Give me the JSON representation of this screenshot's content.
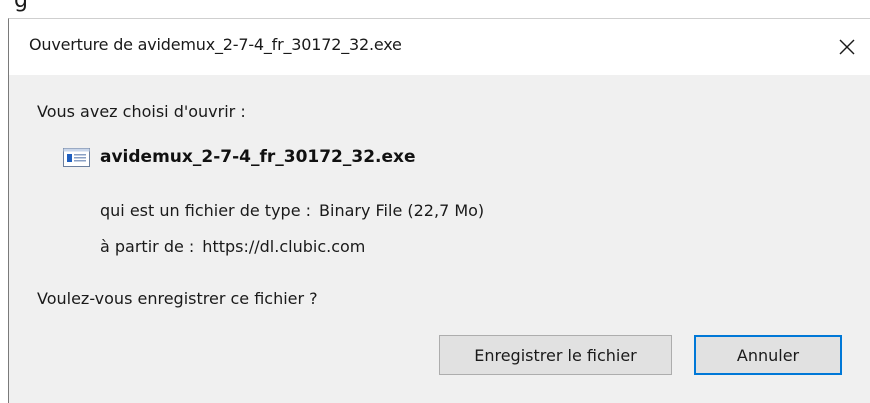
{
  "dialog": {
    "title": "Ouverture de avidemux_2-7-4_fr_30172_32.exe",
    "prompt": "Vous avez choisi d'ouvrir :",
    "file_name": "avidemux_2-7-4_fr_30172_32.exe",
    "type_label": "qui est un fichier de type :",
    "type_value": "Binary File (22,7 Mo)",
    "source_label": "à partir de :",
    "source_value": "https://dl.clubic.com",
    "question": "Voulez-vous enregistrer ce fichier ?",
    "save_label": "Enregistrer le fichier",
    "cancel_label": "Annuler"
  },
  "icons": {
    "close": "close-icon",
    "file": "executable-file-icon"
  },
  "colors": {
    "dialog_bg": "#f0f0f0",
    "focus_border": "#0078d7",
    "file_icon_accent": "#1f5fbf"
  }
}
